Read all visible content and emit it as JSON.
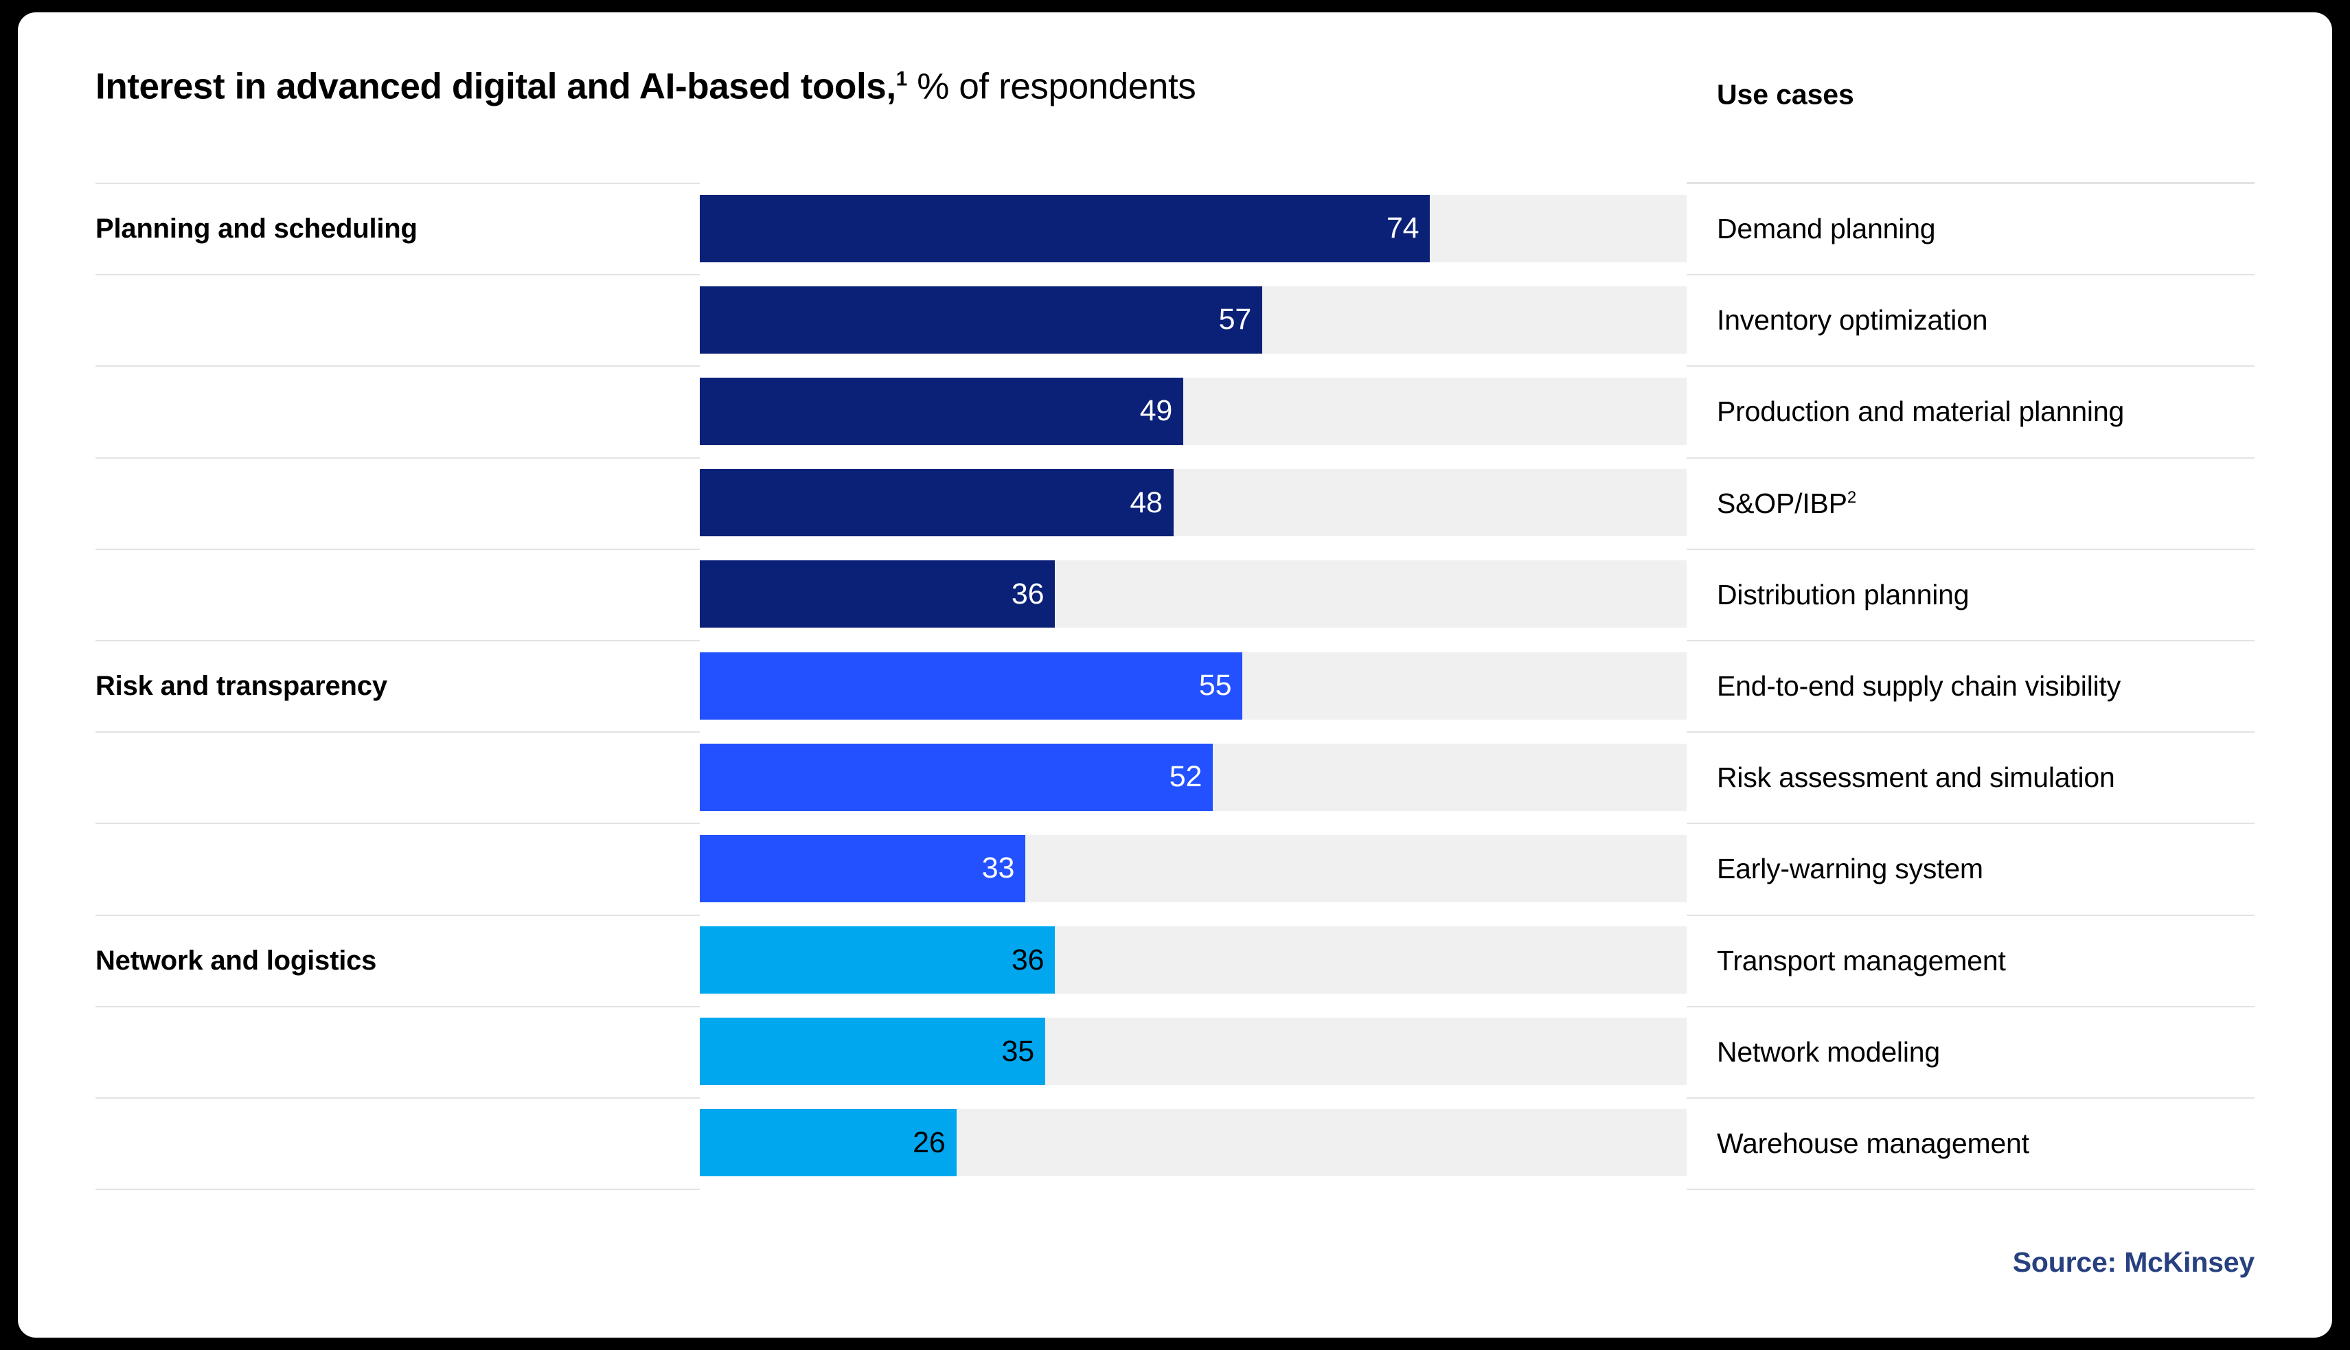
{
  "header": {
    "title_main": "Interest in advanced digital and AI-based tools,",
    "title_footnote_marker": "1",
    "title_sub": " % of respondents",
    "use_cases_header": "Use cases"
  },
  "footer": {
    "source": "Source: McKinsey",
    "source_color": "#27407f"
  },
  "colors": {
    "group_planning": "#0b2178",
    "group_risk": "#2351ff",
    "group_network": "#00a7ef",
    "track": "#f0f0f0",
    "rule": "#e3e3e3",
    "value_light_text": "#ffffff",
    "value_dark_text": "#000000",
    "page_background": "#000000",
    "card_background": "#ffffff"
  },
  "chart_data": {
    "type": "bar",
    "orientation": "horizontal",
    "title": "Interest in advanced digital and AI-based tools,1 % of respondents",
    "xlabel": "% of respondents",
    "ylabel": "",
    "xlim": [
      0,
      100
    ],
    "grid": false,
    "legend": "none",
    "value_axis_max": 100,
    "categories": [
      "Demand planning",
      "Inventory optimization",
      "Production and material planning",
      "S&OP/IBP2",
      "Distribution planning",
      "End-to-end supply chain visibility",
      "Risk assessment and simulation",
      "Early-warning system",
      "Transport management",
      "Network modeling",
      "Warehouse management"
    ],
    "values": [
      74,
      57,
      49,
      48,
      36,
      55,
      52,
      33,
      36,
      35,
      26
    ],
    "groups": [
      {
        "name": "Planning and scheduling",
        "color": "#0b2178",
        "categories": [
          "Demand planning",
          "Inventory optimization",
          "Production and material planning",
          "S&OP/IBP2",
          "Distribution planning"
        ],
        "values": [
          74,
          57,
          49,
          48,
          36
        ]
      },
      {
        "name": "Risk and transparency",
        "color": "#2351ff",
        "categories": [
          "End-to-end supply chain visibility",
          "Risk assessment and simulation",
          "Early-warning system"
        ],
        "values": [
          55,
          52,
          33
        ]
      },
      {
        "name": "Network and logistics",
        "color": "#00a7ef",
        "categories": [
          "Transport management",
          "Network modeling",
          "Warehouse management"
        ],
        "values": [
          36,
          35,
          26
        ]
      }
    ]
  },
  "rows": [
    {
      "category": "Planning and scheduling",
      "use_case": "Demand planning",
      "use_case_sup": "",
      "value": 74,
      "value_text": "74",
      "color": "#0b2178",
      "value_color": "#ffffff"
    },
    {
      "category": "",
      "use_case": "Inventory optimization",
      "use_case_sup": "",
      "value": 57,
      "value_text": "57",
      "color": "#0b2178",
      "value_color": "#ffffff"
    },
    {
      "category": "",
      "use_case": "Production and material planning",
      "use_case_sup": "",
      "value": 49,
      "value_text": "49",
      "color": "#0b2178",
      "value_color": "#ffffff"
    },
    {
      "category": "",
      "use_case": "S&OP/IBP",
      "use_case_sup": "2",
      "value": 48,
      "value_text": "48",
      "color": "#0b2178",
      "value_color": "#ffffff"
    },
    {
      "category": "",
      "use_case": "Distribution planning",
      "use_case_sup": "",
      "value": 36,
      "value_text": "36",
      "color": "#0b2178",
      "value_color": "#ffffff"
    },
    {
      "category": "Risk and transparency",
      "use_case": "End-to-end supply chain visibility",
      "use_case_sup": "",
      "value": 55,
      "value_text": "55",
      "color": "#2351ff",
      "value_color": "#ffffff"
    },
    {
      "category": "",
      "use_case": "Risk assessment and simulation",
      "use_case_sup": "",
      "value": 52,
      "value_text": "52",
      "color": "#2351ff",
      "value_color": "#ffffff"
    },
    {
      "category": "",
      "use_case": "Early-warning system",
      "use_case_sup": "",
      "value": 33,
      "value_text": "33",
      "color": "#2351ff",
      "value_color": "#ffffff"
    },
    {
      "category": "Network and logistics",
      "use_case": "Transport management",
      "use_case_sup": "",
      "value": 36,
      "value_text": "36",
      "color": "#00a7ef",
      "value_color": "#000000"
    },
    {
      "category": "",
      "use_case": "Network modeling",
      "use_case_sup": "",
      "value": 35,
      "value_text": "35",
      "color": "#00a7ef",
      "value_color": "#000000"
    },
    {
      "category": "",
      "use_case": "Warehouse management",
      "use_case_sup": "",
      "value": 26,
      "value_text": "26",
      "color": "#00a7ef",
      "value_color": "#000000"
    }
  ]
}
